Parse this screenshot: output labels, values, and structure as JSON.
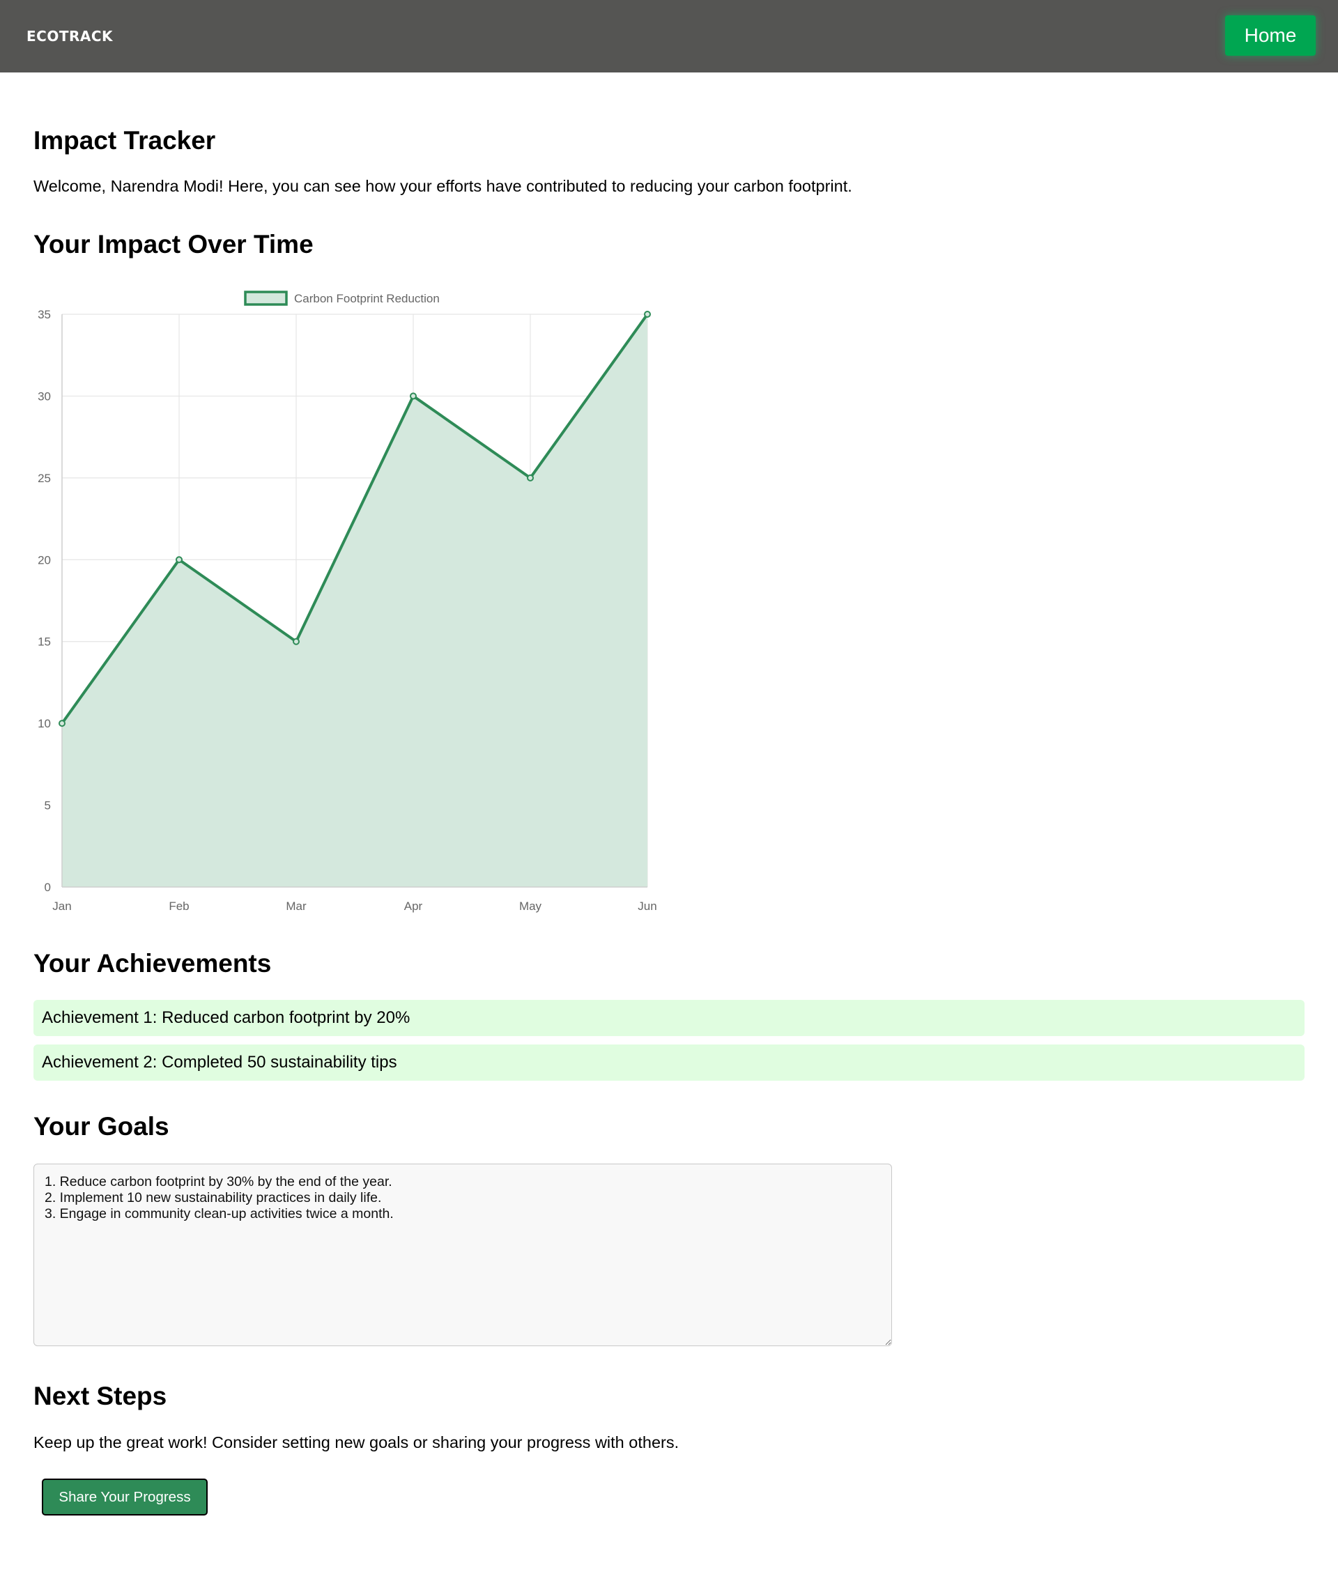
{
  "navbar": {
    "brand": "ECOTRACK",
    "home_label": "Home"
  },
  "page": {
    "title": "Impact Tracker",
    "welcome": "Welcome, Narendra Modi! Here, you can see how your efforts have contributed to reducing your carbon footprint."
  },
  "impact": {
    "heading": "Your Impact Over Time"
  },
  "chart_data": {
    "type": "area",
    "categories": [
      "Jan",
      "Feb",
      "Mar",
      "Apr",
      "May",
      "Jun"
    ],
    "series": [
      {
        "name": "Carbon Footprint Reduction",
        "values": [
          10,
          20,
          15,
          30,
          25,
          35
        ]
      }
    ],
    "ylim": [
      0,
      35
    ],
    "yticks": [
      0,
      5,
      10,
      15,
      20,
      25,
      30,
      35
    ],
    "grid": true,
    "legend": "top-center",
    "colors": {
      "line": "#2e8b57",
      "fill": "#d4e8dd",
      "grid": "#e5e5e5",
      "tick": "#666666"
    }
  },
  "achievements": {
    "heading": "Your Achievements",
    "items": [
      "Achievement 1: Reduced carbon footprint by 20%",
      "Achievement 2: Completed 50 sustainability tips"
    ]
  },
  "goals": {
    "heading": "Your Goals",
    "text": "1. Reduce carbon footprint by 30% by the end of the year.\n2. Implement 10 new sustainability practices in daily life.\n3. Engage in community clean-up activities twice a month."
  },
  "next_steps": {
    "heading": "Next Steps",
    "text": "Keep up the great work! Consider setting new goals or sharing your progress with others.",
    "button_label": "Share Your Progress"
  },
  "colors": {
    "navbar_bg": "#555553",
    "home_button": "#00a651",
    "achievement_bg": "#e0fde0",
    "share_button": "#2e8b57"
  }
}
